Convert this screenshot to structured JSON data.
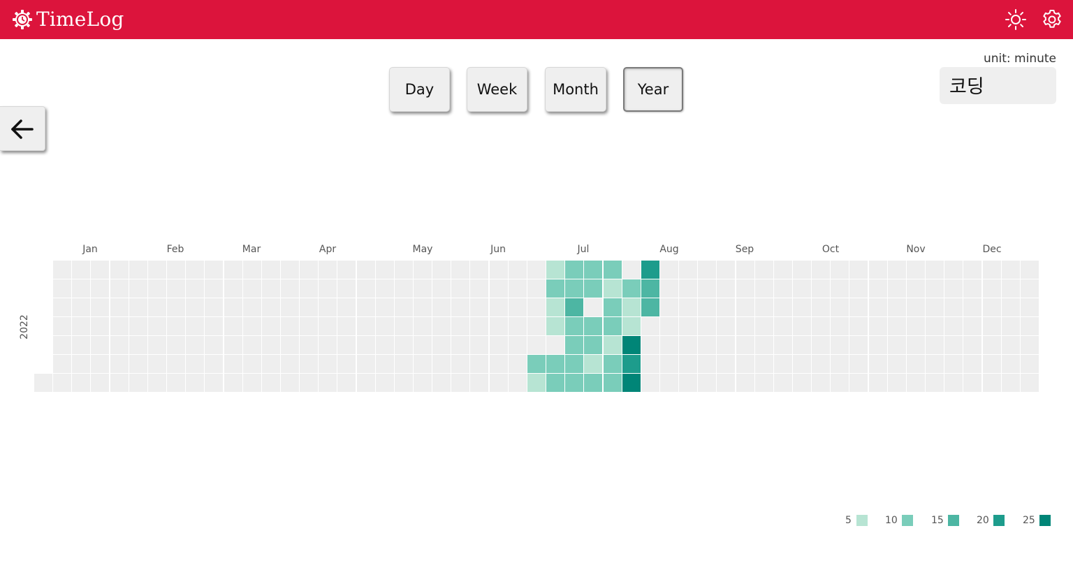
{
  "app": {
    "title": "TimeLog",
    "icons": [
      "logo-clock-gear-icon",
      "sun-icon",
      "gear-icon"
    ]
  },
  "toolbar": {
    "periods": [
      "Day",
      "Week",
      "Month",
      "Year"
    ],
    "active_period": "Year",
    "back_icon": "arrow-left-icon"
  },
  "filter": {
    "unit_label": "unit: minute",
    "category": "코딩"
  },
  "colors": {
    "brand": "#dc143c",
    "empty_cell": "#eeeeee",
    "levels": [
      "#b7e4d3",
      "#7acdba",
      "#4db6a3",
      "#1d9c8c",
      "#008577"
    ]
  },
  "chart_data": {
    "type": "heatmap",
    "year_label": "2022",
    "months": [
      "Jan",
      "Feb",
      "Mar",
      "Apr",
      "May",
      "Jun",
      "Jul",
      "Aug",
      "Sep",
      "Oct",
      "Nov",
      "Dec"
    ],
    "legend": [
      {
        "label": "5",
        "color": "#b7e4d3"
      },
      {
        "label": "10",
        "color": "#7acdba"
      },
      {
        "label": "15",
        "color": "#4db6a3"
      },
      {
        "label": "20",
        "color": "#1d9c8c"
      },
      {
        "label": "25",
        "color": "#008577"
      }
    ],
    "first_week_rows": [
      6
    ],
    "data": [
      {
        "week": 26,
        "values": [
          0,
          0,
          0,
          0,
          0,
          10,
          5
        ]
      },
      {
        "week": 27,
        "values": [
          5,
          10,
          5,
          5,
          0,
          10,
          10
        ]
      },
      {
        "week": 28,
        "values": [
          10,
          10,
          15,
          10,
          10,
          10,
          10
        ]
      },
      {
        "week": 29,
        "values": [
          10,
          10,
          0,
          10,
          10,
          5,
          10
        ]
      },
      {
        "week": 30,
        "values": [
          10,
          5,
          10,
          10,
          5,
          10,
          10
        ]
      },
      {
        "week": 31,
        "values": [
          0,
          10,
          5,
          5,
          25,
          20,
          25
        ]
      },
      {
        "week": 32,
        "values": [
          20,
          15,
          15,
          0,
          0,
          0,
          0
        ]
      }
    ]
  }
}
